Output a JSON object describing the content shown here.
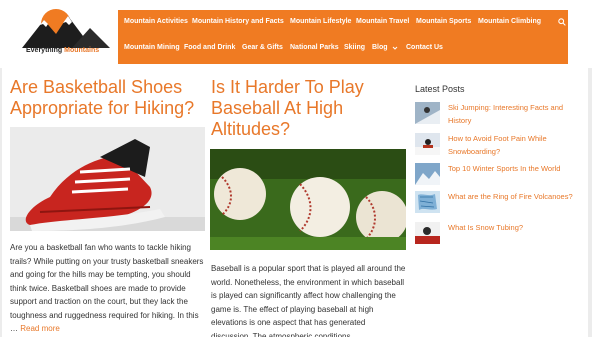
{
  "site": {
    "logo_text_main": "Everything ",
    "logo_text_accent": "Mountains",
    "accent_color": "#e8782a",
    "nav_color": "#f07b22"
  },
  "nav": {
    "row1": [
      "Mountain Activities",
      "Mountain History and Facts",
      "Mountain Lifestyle",
      "Mountain Travel",
      "Mountain Sports",
      "Mountain Climbing"
    ],
    "row2": [
      "Mountain Mining",
      "Food and Drink",
      "Gear & Gifts",
      "National Parks",
      "Skiing",
      "Blog",
      "Contact Us"
    ],
    "search_icon": "search-icon",
    "blog_dropdown_icon": "chevron-down-icon"
  },
  "posts": [
    {
      "title": "Are Basketball Shoes Appropriate for Hiking?",
      "excerpt": "Are you a basketball fan who wants to tackle hiking trails? While putting on your trusty basketball sneakers and going for the hills may be tempting, you should think twice. Basketball shoes are made to provide support and traction on the court, but they lack the toughness and ruggedness required for hiking. In this … ",
      "read_more": "Read more"
    },
    {
      "title": "Is It Harder To Play Baseball At High Altitudes?",
      "excerpt": "Baseball is a popular sport that is played all around the world. Nonetheless, the environment in which baseball is played can significantly affect how challenging the game is. The effect of playing baseball at high elevations is one aspect that has generated discussion. The atmospheric conditions"
    }
  ],
  "sidebar": {
    "title": "Latest Posts",
    "items": [
      "Ski Jumping: Interesting Facts and History",
      "How to Avoid Foot Pain While Snowboarding?",
      "Top 10 Winter Sports In the World",
      "What are the Ring of Fire Volcanoes?",
      "What Is Snow Tubing?"
    ]
  }
}
